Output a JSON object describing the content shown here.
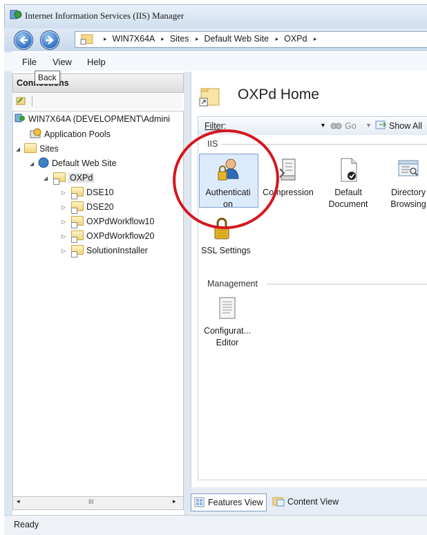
{
  "window": {
    "title": "Internet Information Services (IIS) Manager"
  },
  "address_bar": {
    "crumbs": [
      "WIN7X64A",
      "Sites",
      "Default Web Site",
      "OXPd"
    ],
    "separator": "▸"
  },
  "menu": {
    "items": [
      "File",
      "View",
      "Help"
    ]
  },
  "tooltip": {
    "text": "Back"
  },
  "connections": {
    "title": "Connections",
    "tree": {
      "server": "WIN7X64A (DEVELOPMENT\\Admini",
      "app_pools": "Application Pools",
      "sites": "Sites",
      "default_site": "Default Web Site",
      "oxpd": "OXPd",
      "children": [
        "DSE10",
        "DSE20",
        "OXPdWorkflow10",
        "OXPdWorkflow20",
        "SolutionInstaller"
      ]
    },
    "scroll_thumb": "III"
  },
  "main": {
    "title": "OXPd Home",
    "filter_label": "Filter:",
    "go_label": "Go",
    "show_all_label": "Show All",
    "groups": {
      "iis": "IIS",
      "management": "Management"
    },
    "features": {
      "authentication": [
        "Authenticati",
        "on"
      ],
      "compression": "Compression",
      "default_document": [
        "Default",
        "Document"
      ],
      "directory_browsing": [
        "Directory",
        "Browsing"
      ],
      "ssl_settings": "SSL Settings",
      "config_editor": [
        "Configurat...",
        "Editor"
      ]
    },
    "selected_feature": "Authentication",
    "highlight_color": "#d6161f"
  },
  "view_tabs": {
    "features": "Features View",
    "content": "Content View",
    "active": "Features View"
  },
  "status": {
    "text": "Ready"
  }
}
